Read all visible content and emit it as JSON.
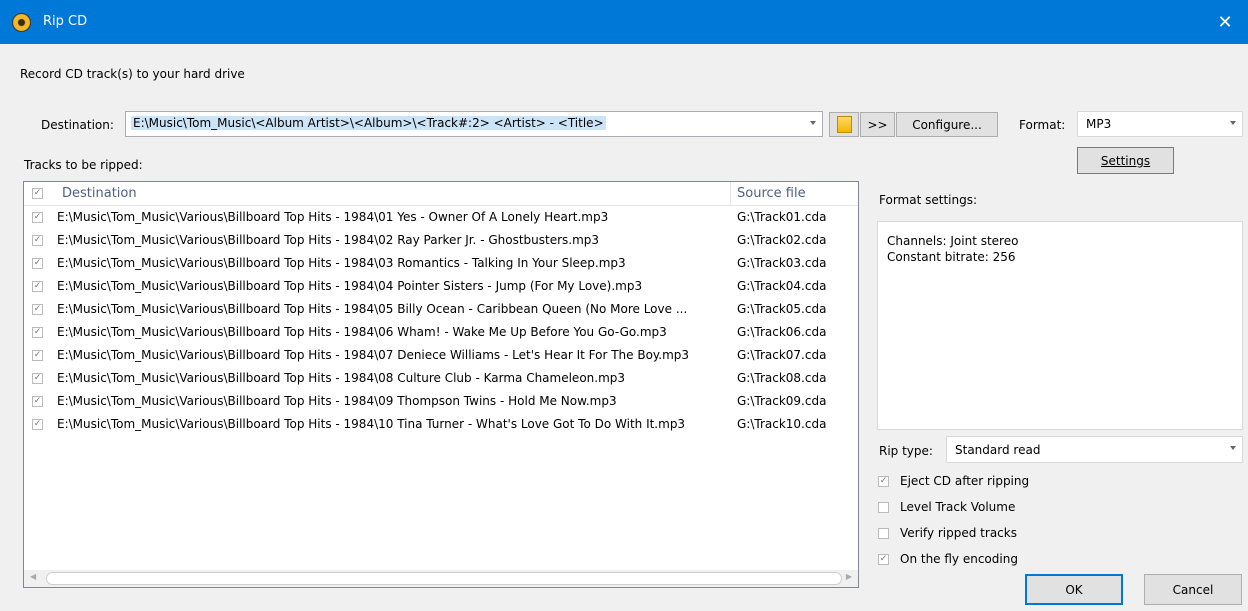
{
  "window": {
    "title": "Rip CD",
    "close_glyph": "✕",
    "app_icon": "cd-icon"
  },
  "intro": "Record CD track(s) to your hard drive",
  "destination": {
    "label": "Destination:",
    "value": "E:\\Music\\Tom_Music\\<Album Artist>\\<Album>\\<Track#:2> <Artist> - <Title>",
    "browse_icon": "folder-icon",
    "more_label": ">>",
    "configure_label": "Configure..."
  },
  "format": {
    "label": "Format:",
    "value": "MP3"
  },
  "settings_label": "Settings",
  "tracks": {
    "label": "Tracks to be ripped:",
    "col_destination": "Destination",
    "col_source": "Source file",
    "rows": [
      {
        "checked": true,
        "destination": "E:\\Music\\Tom_Music\\Various\\Billboard Top Hits - 1984\\01 Yes - Owner Of A Lonely Heart.mp3",
        "source": "G:\\Track01.cda"
      },
      {
        "checked": true,
        "destination": "E:\\Music\\Tom_Music\\Various\\Billboard Top Hits - 1984\\02 Ray Parker Jr. - Ghostbusters.mp3",
        "source": "G:\\Track02.cda"
      },
      {
        "checked": true,
        "destination": "E:\\Music\\Tom_Music\\Various\\Billboard Top Hits - 1984\\03 Romantics - Talking In Your Sleep.mp3",
        "source": "G:\\Track03.cda"
      },
      {
        "checked": true,
        "destination": "E:\\Music\\Tom_Music\\Various\\Billboard Top Hits - 1984\\04 Pointer Sisters - Jump (For My Love).mp3",
        "source": "G:\\Track04.cda"
      },
      {
        "checked": true,
        "destination": "E:\\Music\\Tom_Music\\Various\\Billboard Top Hits - 1984\\05 Billy Ocean - Caribbean Queen (No More Love ...",
        "source": "G:\\Track05.cda"
      },
      {
        "checked": true,
        "destination": "E:\\Music\\Tom_Music\\Various\\Billboard Top Hits - 1984\\06 Wham! - Wake Me Up Before You Go-Go.mp3",
        "source": "G:\\Track06.cda"
      },
      {
        "checked": true,
        "destination": "E:\\Music\\Tom_Music\\Various\\Billboard Top Hits - 1984\\07 Deniece Williams - Let's Hear It For The Boy.mp3",
        "source": "G:\\Track07.cda"
      },
      {
        "checked": true,
        "destination": "E:\\Music\\Tom_Music\\Various\\Billboard Top Hits - 1984\\08 Culture Club - Karma Chameleon.mp3",
        "source": "G:\\Track08.cda"
      },
      {
        "checked": true,
        "destination": "E:\\Music\\Tom_Music\\Various\\Billboard Top Hits - 1984\\09 Thompson Twins - Hold Me Now.mp3",
        "source": "G:\\Track09.cda"
      },
      {
        "checked": true,
        "destination": "E:\\Music\\Tom_Music\\Various\\Billboard Top Hits - 1984\\10 Tina Turner - What's Love Got To Do With It.mp3",
        "source": "G:\\Track10.cda"
      }
    ]
  },
  "format_settings": {
    "label": "Format settings:",
    "lines": [
      "Channels: Joint stereo",
      "Constant bitrate: 256"
    ]
  },
  "rip_type": {
    "label": "Rip type:",
    "value": "Standard read"
  },
  "options": [
    {
      "label": "Eject CD after ripping",
      "checked": true
    },
    {
      "label": "Level Track Volume",
      "checked": false
    },
    {
      "label": "Verify ripped tracks",
      "checked": false
    },
    {
      "label": "On the fly encoding",
      "checked": true
    }
  ],
  "buttons": {
    "ok": "OK",
    "cancel": "Cancel"
  }
}
